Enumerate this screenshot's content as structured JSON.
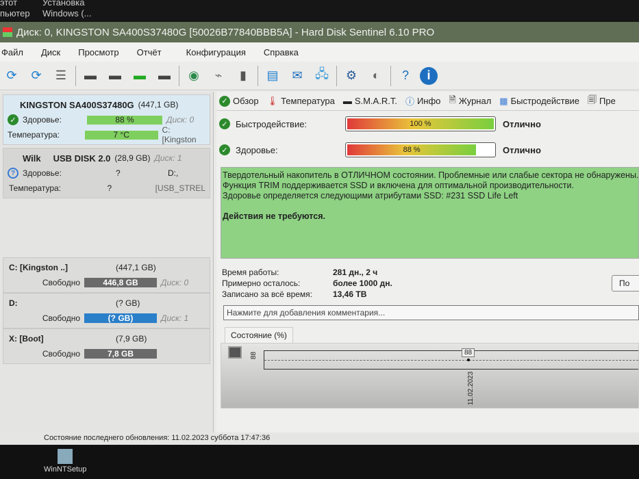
{
  "desktop": {
    "icon1_line1": "этот",
    "icon1_line2": "пьютер",
    "icon2_line1": "Установка",
    "icon2_line2": "Windows (...",
    "bottom_icon": "WinNTSetup"
  },
  "title": "Диск: 0, KINGSTON SA400S37480G [50026B77840BBB5A]  -  Hard Disk Sentinel 6.10 PRO",
  "menu": [
    "Файл",
    "Диск",
    "Просмотр",
    "Отчёт",
    "Конфигурация",
    "Справка"
  ],
  "toolbar": [
    "refresh-icon",
    "refresh-warning-icon",
    "list-icon",
    "disk-tools-icon",
    "disk-clock-icon",
    "disk-check-icon",
    "disk-search-icon",
    "globe-disk-icon",
    "usb-icon",
    "drive-icon",
    "report-icon",
    "mail-icon",
    "network-icon",
    "gear-icon",
    "speaker-icon",
    "help-icon",
    "info-icon"
  ],
  "disks": [
    {
      "name": "KINGSTON SA400S37480G",
      "size": "(447,1 GB)",
      "health_label": "Здоровье:",
      "health": "88 %",
      "temp_label": "Температура:",
      "temp": "7 °C",
      "disk": "Диск: 0",
      "volume": "C: [Kingston"
    },
    {
      "vendor": "Wilk",
      "name": "USB DISK 2.0",
      "size": "(28,9 GB)",
      "disk": "Диск: 1",
      "health_label": "Здоровье:",
      "health": "?",
      "temp_label": "Температура:",
      "temp": "?",
      "volume": "D:,",
      "volume2": "[USB_STREL"
    }
  ],
  "partitions": [
    {
      "name": "C: [Kingston ..]",
      "size": "(447,1 GB)",
      "free_label": "Свободно",
      "free": "446,8 GB",
      "disk": "Диск: 0",
      "color": "#6a6a6a"
    },
    {
      "name": "D:",
      "size": "(? GB)",
      "free_label": "Свободно",
      "free": "(? GB)",
      "disk": "Диск: 1",
      "color": "#2a7fc9"
    },
    {
      "name": "X: [Boot]",
      "size": "(7,9 GB)",
      "free_label": "Свободно",
      "free": "7,8 GB",
      "disk": "",
      "color": "#6a6a6a"
    }
  ],
  "tabs": [
    "Обзор",
    "Температура",
    "S.M.A.R.T.",
    "Инфо",
    "Журнал",
    "Быстродействие",
    "Пре"
  ],
  "performance": {
    "label": "Быстродействие:",
    "value": "100 %",
    "percent": 100,
    "result": "Отлично"
  },
  "health": {
    "label": "Здоровье:",
    "value": "88 %",
    "percent": 88,
    "result": "Отлично"
  },
  "message": {
    "line1": "Твердотельный накопитель в ОТЛИЧНОМ состоянии. Проблемные или слабые сектора не обнаружены.",
    "line2": "Функция TRIM поддерживается SSD и включена для оптимальной производительности.",
    "line3": "Здоровье определяется следующими атрибутами SSD: #231 SSD Life Left",
    "action": "Действия не требуются."
  },
  "stats": [
    {
      "k": "Время работы:",
      "v": "281 дн., 2 ч"
    },
    {
      "k": "Примерно осталось:",
      "v": "более 1000 дн."
    },
    {
      "k": "Записано за всё время:",
      "v": "13,46 TB"
    }
  ],
  "side_button": "По",
  "comment_placeholder": "Нажмите для добавления комментария...",
  "chart_tab": "Состояние (%)",
  "chart_data": {
    "type": "line",
    "title": "Состояние (%)",
    "x": [
      "11.02.2023"
    ],
    "values": [
      88
    ],
    "ytick": "88",
    "point_label": "88"
  },
  "statusbar": "Состояние последнего обновления: 11.02.2023 суббота 17:47:36"
}
